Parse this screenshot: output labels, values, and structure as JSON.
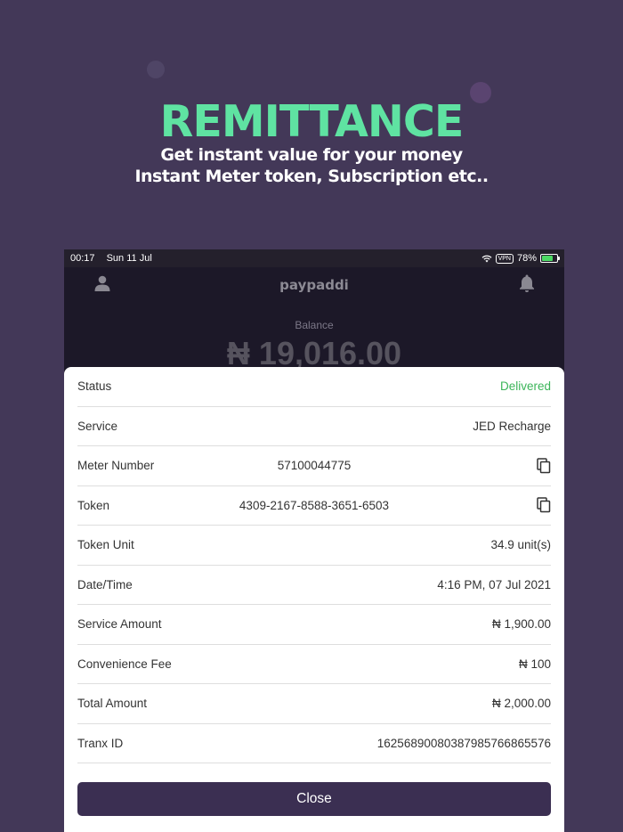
{
  "promo": {
    "title": "REMITTANCE",
    "line1": "Get instant value for your money",
    "line2": "Instant Meter token, Subscription etc.."
  },
  "status_bar": {
    "time": "00:17",
    "date": "Sun 11 Jul",
    "vpn": "VPN",
    "battery": "78%",
    "battery_level": 0.78
  },
  "app_bar": {
    "logo": "paypaddi",
    "left_icon": "user-icon",
    "right_icon": "bell-icon"
  },
  "balance": {
    "label": "Balance",
    "amount": "₦ 19,016.00"
  },
  "details": {
    "status": {
      "label": "Status",
      "value": "Delivered",
      "color": "#3cb55a"
    },
    "service": {
      "label": "Service",
      "value": "JED Recharge"
    },
    "meter": {
      "label": "Meter Number",
      "value": "57100044775"
    },
    "token": {
      "label": "Token",
      "value": "4309-2167-8588-3651-6503"
    },
    "unit": {
      "label": "Token Unit",
      "value": "34.9 unit(s)"
    },
    "datetime": {
      "label": "Date/Time",
      "value": "4:16 PM, 07 Jul 2021"
    },
    "service_amount": {
      "label": "Service Amount",
      "value": "₦ 1,900.00"
    },
    "fee": {
      "label": "Convenience Fee",
      "value": "₦ 100"
    },
    "total": {
      "label": "Total Amount",
      "value": "₦ 2,000.00"
    },
    "tranx": {
      "label": "Tranx ID",
      "value": "16256890080387985766865576"
    }
  },
  "close_label": "Close",
  "colors": {
    "background": "#433858",
    "accent_green": "#5fe3a2",
    "button": "#3b2f52"
  }
}
